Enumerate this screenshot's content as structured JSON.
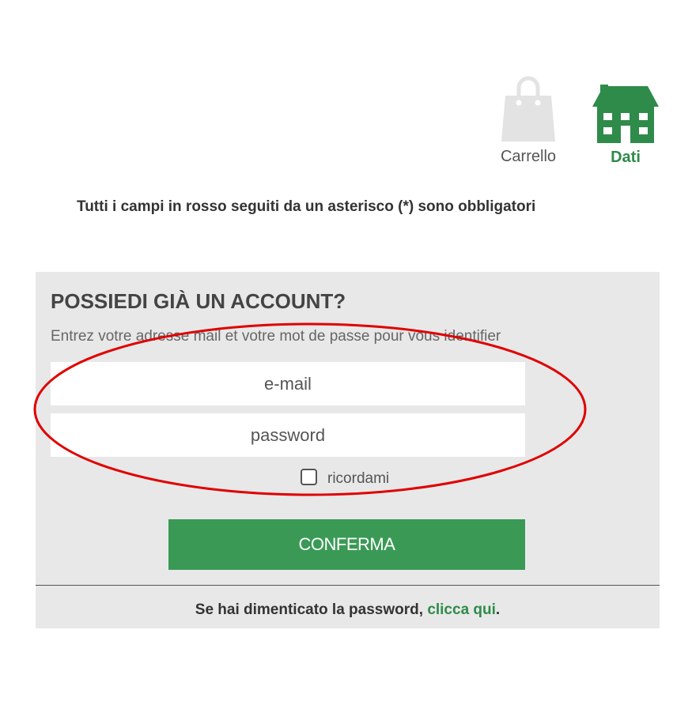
{
  "steps": {
    "cart": {
      "label": "Carrello",
      "icon": "shopping-bag-icon",
      "color": "#e3e3e3"
    },
    "dati": {
      "label": "Dati",
      "icon": "house-icon",
      "color": "#2e8b4a"
    }
  },
  "required_note": "Tutti i campi in rosso seguiti da un asterisco (*) sono obbligatori",
  "login": {
    "title": "POSSIEDI GIÀ UN ACCOUNT?",
    "subtitle": "Entrez votre adresse mail et votre mot de passe pour vous identifier",
    "email_placeholder": "e-mail",
    "email_value": "",
    "password_placeholder": "password",
    "password_value": "",
    "remember_label": "ricordami",
    "remember_checked": false,
    "confirm_label": "CONFERMA",
    "forgot_text": "Se hai dimenticato la password, ",
    "forgot_link": "clicca qui",
    "forgot_end": "."
  },
  "colors": {
    "accent_green": "#3a9a55",
    "panel_bg": "#e8e8e8",
    "annotation_red": "#e00000"
  }
}
